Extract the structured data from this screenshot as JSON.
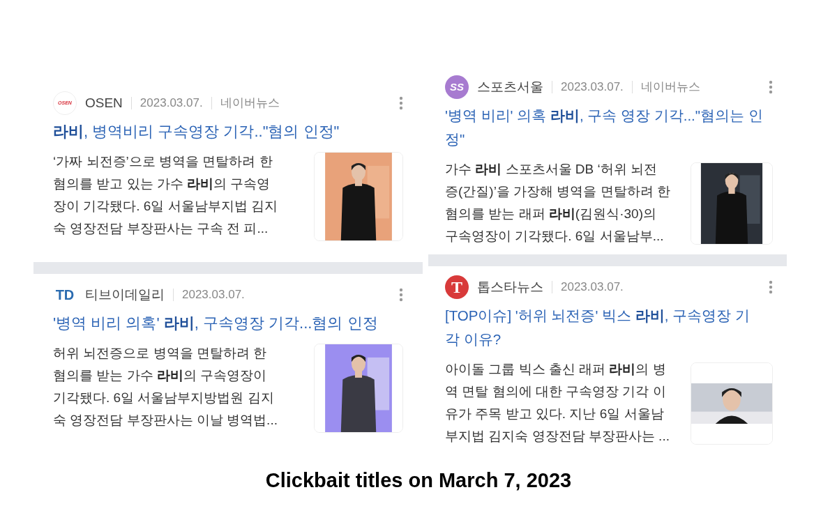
{
  "columns": [
    {
      "articles": [
        {
          "logo": "OSEN",
          "source": "OSEN",
          "date": "2023.03.07.",
          "platform": "네이버뉴스",
          "title_lines": [
            "**라비**, 병역비리 구속영장 기각..\"혐의 인정\""
          ],
          "snippet_lines": [
            "‘가짜 뇌전증’으로 병역을 면탈하려 한",
            "혐의를 받고 있는 가수 **라비**의 구속영",
            "장이 기각됐다. 6일 서울남부지법 김지",
            "숙 영장전담 부장판사는 구속 전 피..."
          ],
          "image": {
            "kind": "picture"
          }
        },
        {
          "logo": "TD",
          "source": "티브이데일리",
          "date": "2023.03.07.",
          "title_lines": [
            "'병역 비리 의혹' **라비**, 구속영장 기각...혐의 인정"
          ],
          "snippet_lines": [
            "허위 뇌전증으로 병역을 면탈하려 한",
            "혐의를 받는 가수 **라비**의 구속영장이",
            "기각됐다. 6일 서울남부지방법원 김지",
            "숙 영장전담 부장판사는 이날 병역법..."
          ],
          "image": {
            "kind": "picture"
          }
        }
      ]
    },
    {
      "articles": [
        {
          "logo": "SS",
          "source": "스포츠서울",
          "date": "2023.03.07.",
          "platform": "네이버뉴스",
          "title_lines": [
            "'병역 비리' 의혹 **라비**, 구속 영장 기각...\"혐의는 인",
            "정\""
          ],
          "snippet_lines": [
            "가수 **라비** 스포츠서울 DB ‘허위 뇌전",
            "증(간질)’을 가장해 병역을 면탈하려 한",
            "혐의를 받는 래퍼 **라비**(김원식·30)의",
            "구속영장이 기각됐다. 6일 서울남부..."
          ],
          "image": {
            "kind": "picture"
          }
        },
        {
          "logo": "T",
          "source": "톱스타뉴스",
          "date": "2023.03.07.",
          "title_lines": [
            "[TOP이슈] '허위 뇌전증' 빅스 **라비**, 구속영장 기",
            "각 이유?"
          ],
          "snippet_lines": [
            "아이돌 그룹 빅스 출신 래퍼 **라비**의 병",
            "역 면탈 혐의에 대한 구속영장 기각 이",
            "유가 주목 받고 있다. 지난 6일 서울남",
            "부지법 김지숙 영장전담 부장판사는 ..."
          ],
          "image": {
            "kind": "picture"
          }
        }
      ]
    }
  ],
  "caption": "Clickbait titles on March 7, 2023"
}
